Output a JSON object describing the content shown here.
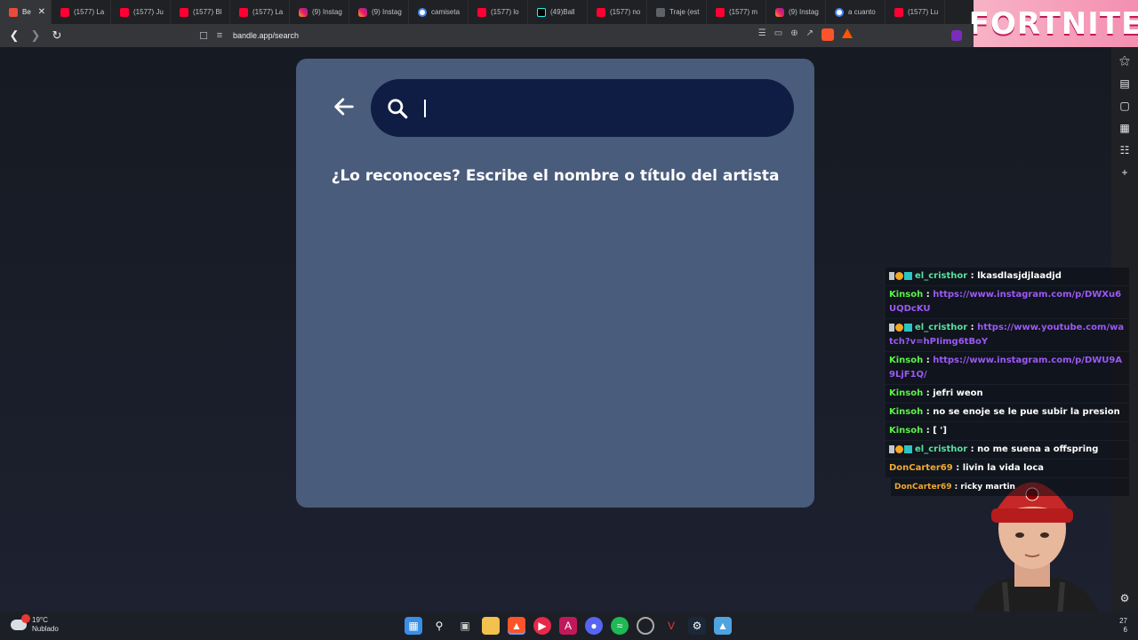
{
  "browser": {
    "tabs": [
      {
        "title": "Be",
        "favicon": "bandle-icon",
        "active": true
      },
      {
        "title": "(1577) La",
        "favicon": "youtube-icon"
      },
      {
        "title": "(1577) Ju",
        "favicon": "youtube-icon"
      },
      {
        "title": "(1577) Bl",
        "favicon": "youtube-icon"
      },
      {
        "title": "(1577) La",
        "favicon": "youtube-icon"
      },
      {
        "title": "(9) Instag",
        "favicon": "instagram-icon"
      },
      {
        "title": "(9) Instag",
        "favicon": "instagram-icon"
      },
      {
        "title": "camiseta",
        "favicon": "google-icon"
      },
      {
        "title": "(1577) lo",
        "favicon": "youtube-icon"
      },
      {
        "title": "(49)Ball",
        "favicon": "tiktok-icon"
      },
      {
        "title": "(1577) no",
        "favicon": "youtube-icon"
      },
      {
        "title": "Traje (est",
        "favicon": "translate-icon"
      },
      {
        "title": "(1577) m",
        "favicon": "youtube-icon"
      },
      {
        "title": "(9) Instag",
        "favicon": "instagram-icon"
      },
      {
        "title": "a cuanto",
        "favicon": "google-icon"
      },
      {
        "title": "(1577) Lu",
        "favicon": "youtube-icon"
      }
    ],
    "url": "bandle.app/search",
    "banner_text": "FORTNITE"
  },
  "app": {
    "search_placeholder": "",
    "prompt": "¿Lo reconoces? Escribe el nombre o título del artista"
  },
  "chat": {
    "messages": [
      {
        "user": "el_cristhor",
        "user_color": "#58e0a0",
        "badges": true,
        "text": "lkasdlasjdjlaadjd",
        "is_link": false
      },
      {
        "user": "Kinsoh",
        "user_color": "#5cf24a",
        "badges": false,
        "text": "https://www.instagram.com/p/DWXu6UQDcKU",
        "is_link": true
      },
      {
        "user": "el_cristhor",
        "user_color": "#58e0a0",
        "badges": true,
        "text": "https://www.youtube.com/watch?v=hPIimg6tBoY",
        "is_link": true
      },
      {
        "user": "Kinsoh",
        "user_color": "#5cf24a",
        "badges": false,
        "text": "https://www.instagram.com/p/DWU9A9LjF1Q/",
        "is_link": true
      },
      {
        "user": "Kinsoh",
        "user_color": "#5cf24a",
        "badges": false,
        "text": "jefri weon",
        "is_link": false
      },
      {
        "user": "Kinsoh",
        "user_color": "#5cf24a",
        "badges": false,
        "text": "no se enoje se le pue subir la presion",
        "is_link": false
      },
      {
        "user": "Kinsoh",
        "user_color": "#5cf24a",
        "badges": false,
        "text": "[ ']",
        "is_link": false
      },
      {
        "user": "el_cristhor",
        "user_color": "#58e0a0",
        "badges": true,
        "text": "no me suena a offspring",
        "is_link": false
      },
      {
        "user": "DonCarter69",
        "user_color": "#f0a830",
        "badges": false,
        "text": "livin la vida loca",
        "is_link": false
      },
      {
        "user": "DonCarter69",
        "user_color": "#f0a830",
        "badges": false,
        "text": "ricky martin",
        "is_link": false
      }
    ]
  },
  "taskbar": {
    "temperature": "19°C",
    "condition": "Nublado",
    "clock_line1": "27",
    "clock_line2": "6"
  }
}
